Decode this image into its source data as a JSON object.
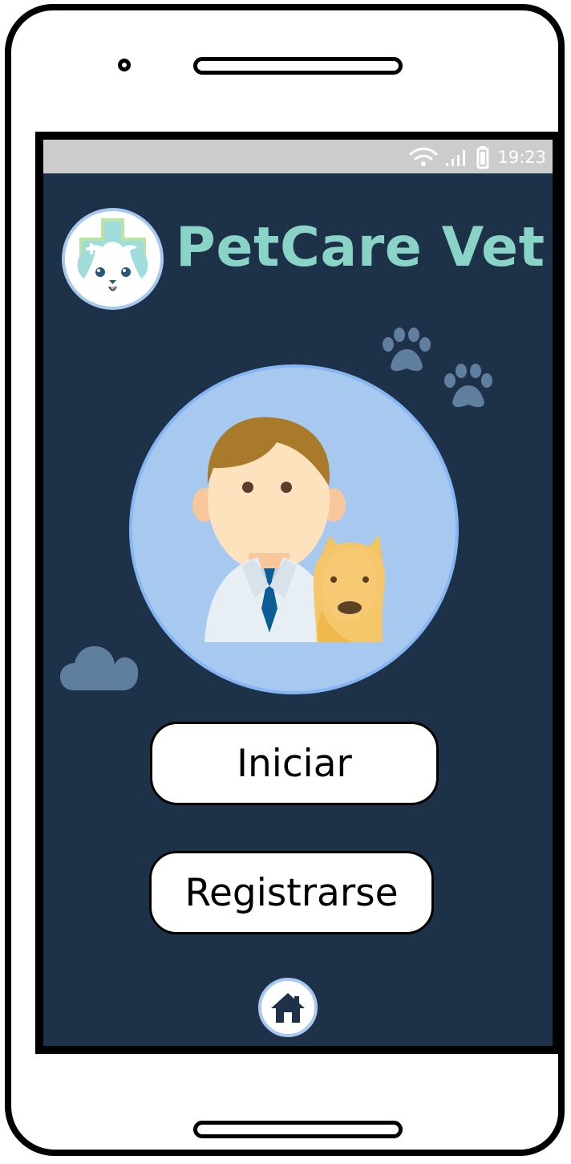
{
  "status": {
    "time": "19:23",
    "icons": [
      "wifi-icon",
      "signal-icon",
      "battery-icon"
    ]
  },
  "app": {
    "title": "PetCare Vet",
    "logo_icon": "pet-health-logo-icon"
  },
  "hero": {
    "icon": "veterinarian-with-dog-illustration"
  },
  "actions": {
    "start_label": "Iniciar",
    "register_label": "Registrarse"
  },
  "navigation": {
    "home_icon": "home-icon"
  },
  "colors": {
    "screen_background": "#1d3149",
    "status_bar": "#cccccc",
    "title_teal": "#8ad3c7",
    "hero_blue": "#a7c9f0",
    "accent_gray_blue": "#607f9f",
    "button_background": "#ffffff",
    "outline": "#000000"
  }
}
